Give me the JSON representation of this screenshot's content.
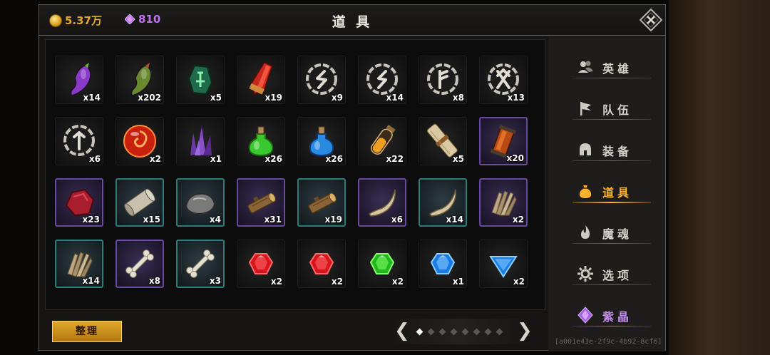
{
  "header": {
    "title": "道 具",
    "gold": "5.37万",
    "gems": "810",
    "gold_color": "#e3a72a",
    "gem_color": "#c070f0"
  },
  "grid": [
    {
      "name": "purple-fruit",
      "qty": "x14",
      "frame": "plain"
    },
    {
      "name": "green-fruit",
      "qty": "x202",
      "frame": "plain"
    },
    {
      "name": "green-rune-stone",
      "qty": "x5",
      "frame": "plain"
    },
    {
      "name": "red-crystal",
      "qty": "x19",
      "frame": "plain"
    },
    {
      "name": "rune-sowilo",
      "qty": "x9",
      "frame": "plain"
    },
    {
      "name": "rune-sowilo-2",
      "qty": "x14",
      "frame": "plain"
    },
    {
      "name": "rune-fehu",
      "qty": "x8",
      "frame": "plain"
    },
    {
      "name": "rune-othala",
      "qty": "x13",
      "frame": "plain"
    },
    {
      "name": "rune-tiwaz",
      "qty": "x6",
      "frame": "plain"
    },
    {
      "name": "fire-orb",
      "qty": "x2",
      "frame": "plain"
    },
    {
      "name": "purple-crystal-cluster",
      "qty": "x1",
      "frame": "plain"
    },
    {
      "name": "green-potion",
      "qty": "x26",
      "frame": "plain"
    },
    {
      "name": "blue-potion",
      "qty": "x26",
      "frame": "plain"
    },
    {
      "name": "orange-vial",
      "qty": "x22",
      "frame": "plain"
    },
    {
      "name": "scroll-bundle",
      "qty": "x5",
      "frame": "plain"
    },
    {
      "name": "amber-lantern",
      "qty": "x20",
      "frame": "purple"
    },
    {
      "name": "red-ore",
      "qty": "x23",
      "frame": "purple"
    },
    {
      "name": "paper-scroll",
      "qty": "x15",
      "frame": "teal"
    },
    {
      "name": "grey-stone",
      "qty": "x4",
      "frame": "teal"
    },
    {
      "name": "wood-log",
      "qty": "x31",
      "frame": "purple"
    },
    {
      "name": "wood-log-2",
      "qty": "x19",
      "frame": "teal"
    },
    {
      "name": "horn",
      "qty": "x6",
      "frame": "purple"
    },
    {
      "name": "horn-2",
      "qty": "x14",
      "frame": "teal"
    },
    {
      "name": "fur-pelt",
      "qty": "x2",
      "frame": "purple"
    },
    {
      "name": "fur-pelt-2",
      "qty": "x14",
      "frame": "teal"
    },
    {
      "name": "bone",
      "qty": "x8",
      "frame": "purple"
    },
    {
      "name": "bone-2",
      "qty": "x3",
      "frame": "teal"
    },
    {
      "name": "red-gem",
      "qty": "x2",
      "frame": "plain"
    },
    {
      "name": "red-gem-2",
      "qty": "x2",
      "frame": "plain"
    },
    {
      "name": "green-gem",
      "qty": "x2",
      "frame": "plain"
    },
    {
      "name": "blue-gem",
      "qty": "x1",
      "frame": "plain"
    },
    {
      "name": "blue-gem-2",
      "qty": "x2",
      "frame": "plain"
    }
  ],
  "tidy_button": "整理",
  "pager": {
    "pages": 8,
    "current": 1,
    "prev": "❮",
    "next": "❯"
  },
  "nav": [
    {
      "label": "英雄",
      "icon": "heroes-icon",
      "state": "normal"
    },
    {
      "label": "队伍",
      "icon": "flag-icon",
      "state": "normal"
    },
    {
      "label": "装备",
      "icon": "helmet-icon",
      "state": "normal"
    },
    {
      "label": "道具",
      "icon": "bag-icon",
      "state": "active"
    },
    {
      "label": "魔魂",
      "icon": "flame-icon",
      "state": "normal"
    },
    {
      "label": "选项",
      "icon": "gear-icon",
      "state": "normal"
    },
    {
      "label": "紫晶",
      "icon": "amethyst-icon",
      "state": "purple"
    }
  ],
  "accent_color": "#ffb22a",
  "build_hash": "[a001e43e-2f9c-4b92-8cf6]"
}
